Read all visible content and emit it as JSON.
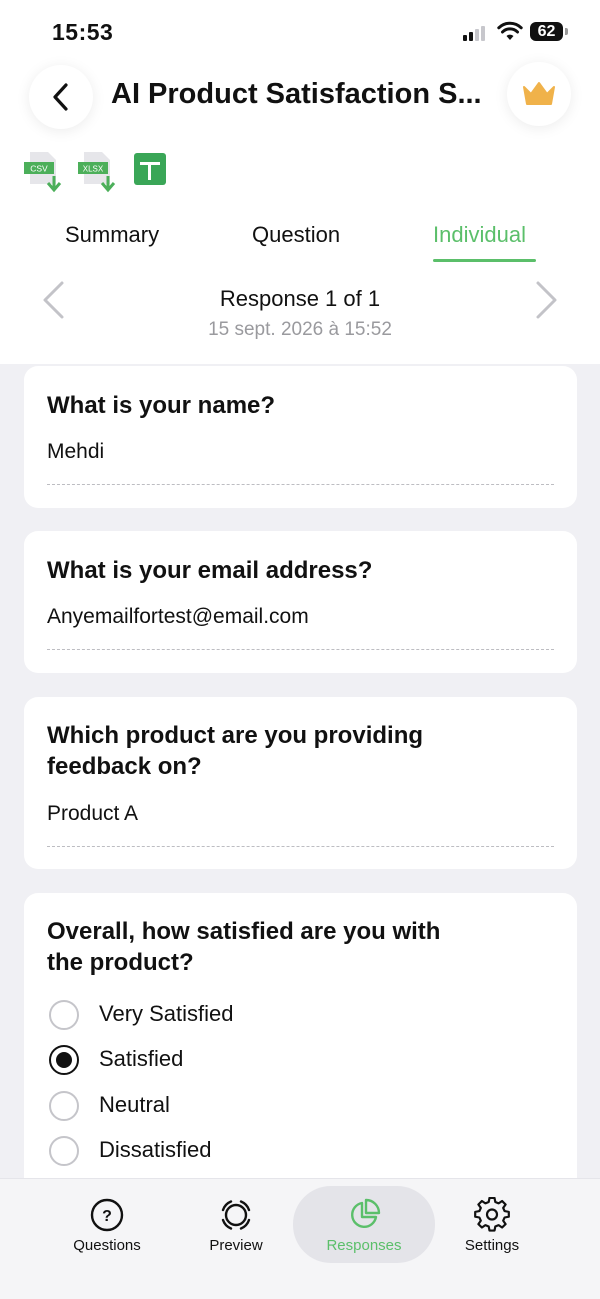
{
  "status_bar": {
    "time": "15:53",
    "battery": "62"
  },
  "header": {
    "title": "AI Product Satisfaction S..."
  },
  "export": {
    "csv_label": "CSV",
    "xlsx_label": "XLSX"
  },
  "tabs": [
    {
      "label": "Summary",
      "active": false
    },
    {
      "label": "Question",
      "active": false
    },
    {
      "label": "Individual",
      "active": true
    }
  ],
  "pager": {
    "title": "Response 1 of 1",
    "date": "15 sept. 2026 à 15:52"
  },
  "responses": [
    {
      "question": "What is your name?",
      "answer": "Mehdi"
    },
    {
      "question": "What is your email address?",
      "answer": "Anyemailfortest@email.com"
    },
    {
      "question": "Which product are you providing feedback on?",
      "answer": "Product A"
    },
    {
      "question": "Overall, how satisfied are you with the product?",
      "options": [
        {
          "label": "Very Satisfied",
          "selected": false
        },
        {
          "label": "Satisfied",
          "selected": true
        },
        {
          "label": "Neutral",
          "selected": false
        },
        {
          "label": "Dissatisfied",
          "selected": false
        }
      ]
    }
  ],
  "bottom_nav": [
    {
      "label": "Questions",
      "icon": "question-circle-icon",
      "active": false
    },
    {
      "label": "Preview",
      "icon": "preview-icon",
      "active": false
    },
    {
      "label": "Responses",
      "icon": "pie-chart-icon",
      "active": true
    },
    {
      "label": "Settings",
      "icon": "gear-icon",
      "active": false
    }
  ],
  "colors": {
    "accent": "#5bbf6a",
    "crown": "#f0b24a",
    "background": "#f0f0f4"
  }
}
